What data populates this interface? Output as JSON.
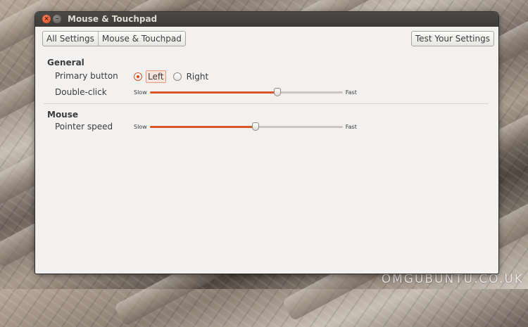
{
  "window": {
    "title": "Mouse & Touchpad"
  },
  "breadcrumb": [
    "All Settings",
    "Mouse & Touchpad"
  ],
  "toolbar": {
    "test_label": "Test Your Settings"
  },
  "general": {
    "heading": "General",
    "primary_button": {
      "label": "Primary button",
      "options": [
        "Left",
        "Right"
      ],
      "selected": "Left"
    },
    "double_click": {
      "label": "Double-click",
      "min_label": "Slow",
      "max_label": "Fast",
      "value": 0.66
    }
  },
  "mouse": {
    "heading": "Mouse",
    "pointer_speed": {
      "label": "Pointer speed",
      "min_label": "Slow",
      "max_label": "Fast",
      "value": 0.55
    }
  },
  "watermark": "OMGUBUNTU.CO.UK",
  "colors": {
    "accent": "#df4a16",
    "titlebar": "#3c3b37",
    "window_bg": "#f2f1f0"
  },
  "icons": {
    "close": "close-icon",
    "minimize": "minimize-icon"
  }
}
